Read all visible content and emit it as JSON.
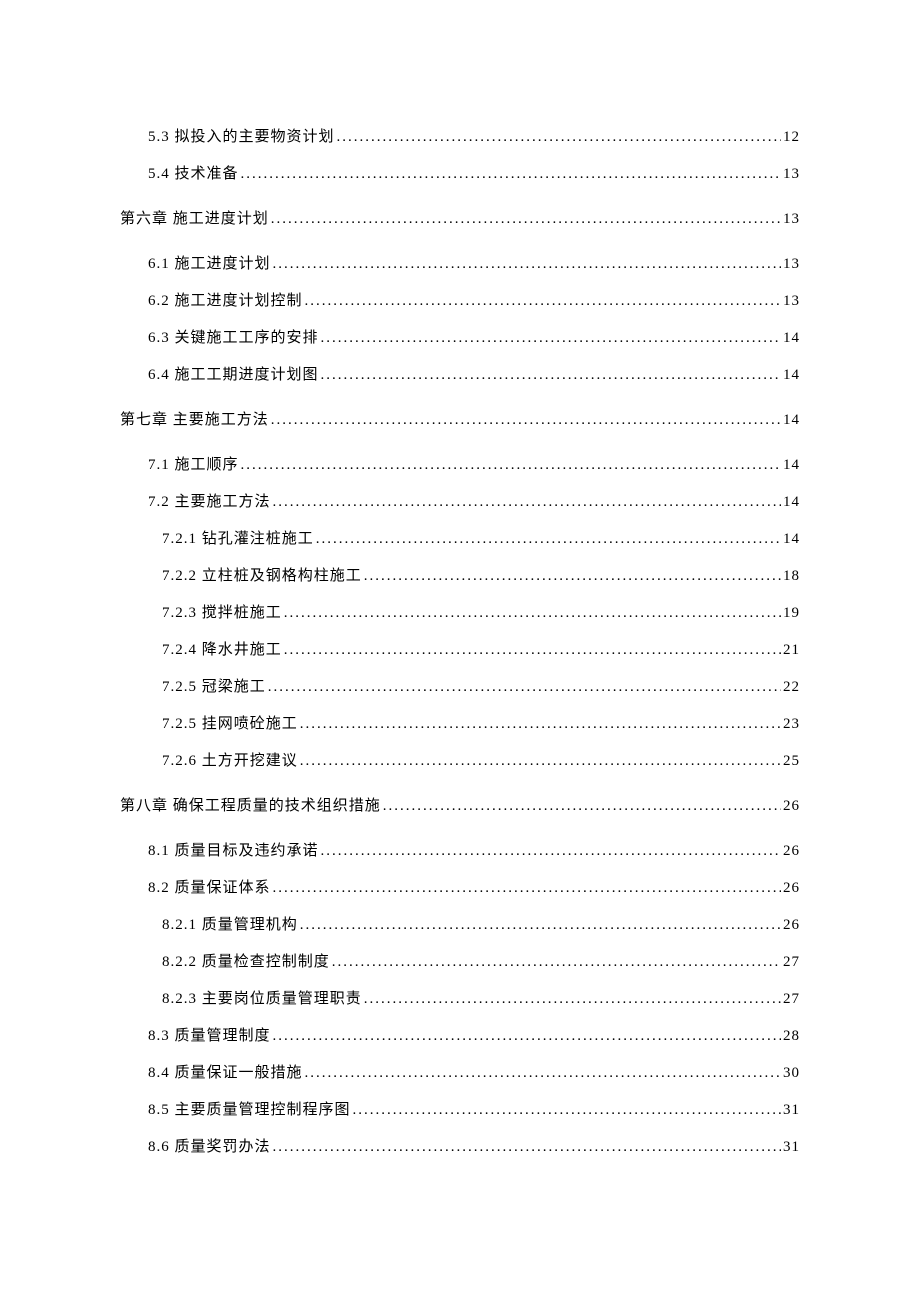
{
  "toc": [
    {
      "level": 1,
      "label": "5.3 拟投入的主要物资计划",
      "page": "12"
    },
    {
      "level": 1,
      "label": "5.4 技术准备",
      "page": "13"
    },
    {
      "level": 0,
      "label": "第六章 施工进度计划",
      "page": "13",
      "chapter": true
    },
    {
      "level": 1,
      "label": "6.1 施工进度计划",
      "page": "13"
    },
    {
      "level": 1,
      "label": "6.2 施工进度计划控制",
      "page": "13"
    },
    {
      "level": 1,
      "label": "6.3 关键施工工序的安排",
      "page": "14"
    },
    {
      "level": 1,
      "label": "6.4 施工工期进度计划图",
      "page": "14"
    },
    {
      "level": 0,
      "label": "第七章 主要施工方法",
      "page": "14",
      "chapter": true
    },
    {
      "level": 1,
      "label": "7.1 施工顺序",
      "page": "14"
    },
    {
      "level": 1,
      "label": "7.2 主要施工方法",
      "page": "14"
    },
    {
      "level": 2,
      "label": "7.2.1 钻孔灌注桩施工",
      "page": "14"
    },
    {
      "level": 2,
      "label": "7.2.2 立柱桩及钢格构柱施工",
      "page": "18"
    },
    {
      "level": 2,
      "label": "7.2.3 搅拌桩施工",
      "page": "19"
    },
    {
      "level": 2,
      "label": "7.2.4 降水井施工",
      "page": "21"
    },
    {
      "level": 2,
      "label": "7.2.5 冠梁施工",
      "page": "22"
    },
    {
      "level": 2,
      "label": "7.2.5 挂网喷砼施工",
      "page": "23"
    },
    {
      "level": 2,
      "label": "7.2.6 土方开挖建议",
      "page": "25"
    },
    {
      "level": 0,
      "label": "第八章 确保工程质量的技术组织措施",
      "page": "26",
      "chapter": true
    },
    {
      "level": 1,
      "label": "8.1 质量目标及违约承诺",
      "page": "26"
    },
    {
      "level": 1,
      "label": "8.2 质量保证体系",
      "page": "26"
    },
    {
      "level": 2,
      "label": "8.2.1 质量管理机构",
      "page": "26"
    },
    {
      "level": 2,
      "label": "8.2.2 质量检查控制制度",
      "page": "27"
    },
    {
      "level": 2,
      "label": "8.2.3 主要岗位质量管理职责",
      "page": "27"
    },
    {
      "level": 1,
      "label": "8.3 质量管理制度",
      "page": "28"
    },
    {
      "level": 1,
      "label": "8.4 质量保证一般措施",
      "page": "30"
    },
    {
      "level": 1,
      "label": "8.5 主要质量管理控制程序图",
      "page": "31"
    },
    {
      "level": 1,
      "label": "8.6 质量奖罚办法",
      "page": "31"
    }
  ]
}
